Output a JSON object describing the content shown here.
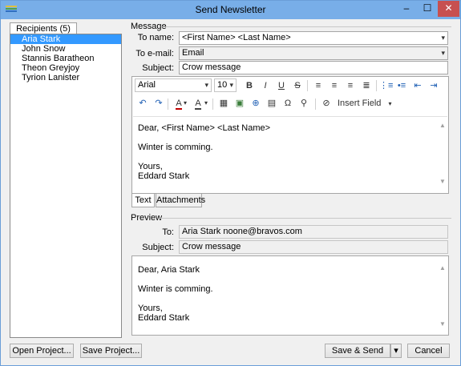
{
  "window": {
    "title": "Send Newsletter",
    "min_glyph": "–",
    "max_glyph": "☐",
    "close_glyph": "✕"
  },
  "recipients": {
    "tab_label": "Recipients (5)",
    "items": [
      "Aria Stark",
      "John Snow",
      "Stannis Baratheon",
      "Theon Greyjoy",
      "Tyrion Lanister"
    ],
    "selected_index": 0
  },
  "message": {
    "section_label": "Message",
    "to_name_label": "To name:",
    "to_name_value": "<First Name> <Last Name>",
    "to_email_label": "To e-mail:",
    "to_email_value": "Email",
    "subject_label": "Subject:",
    "subject_value": "Crow message"
  },
  "toolbar": {
    "font": "Arial",
    "size": "10",
    "bold": "B",
    "italic": "I",
    "underline": "U",
    "strike": "S",
    "insert_field": "Insert Field"
  },
  "editor": {
    "line1": "Dear, <First Name> <Last Name>",
    "line2": "Winter is comming.",
    "line3": "Yours,",
    "line4": "Eddard Stark"
  },
  "editor_tabs": {
    "text": "Text",
    "attachments": "Attachments"
  },
  "preview": {
    "section_label": "Preview",
    "to_label": "To:",
    "to_value": "Aria Stark noone@bravos.com",
    "subject_label": "Subject:",
    "subject_value": "Crow message",
    "line1": "Dear, Aria Stark",
    "line2": "Winter is comming.",
    "line3": "Yours,",
    "line4": "Eddard Stark"
  },
  "buttons": {
    "open_project": "Open Project...",
    "save_project": "Save Project...",
    "save_send": "Save & Send",
    "cancel": "Cancel",
    "dropdown_glyph": "▾"
  },
  "colors": {
    "titlebar": "#78aee8",
    "selection": "#3399ff",
    "close": "#c75050",
    "link_blue": "#1e5fb4"
  }
}
